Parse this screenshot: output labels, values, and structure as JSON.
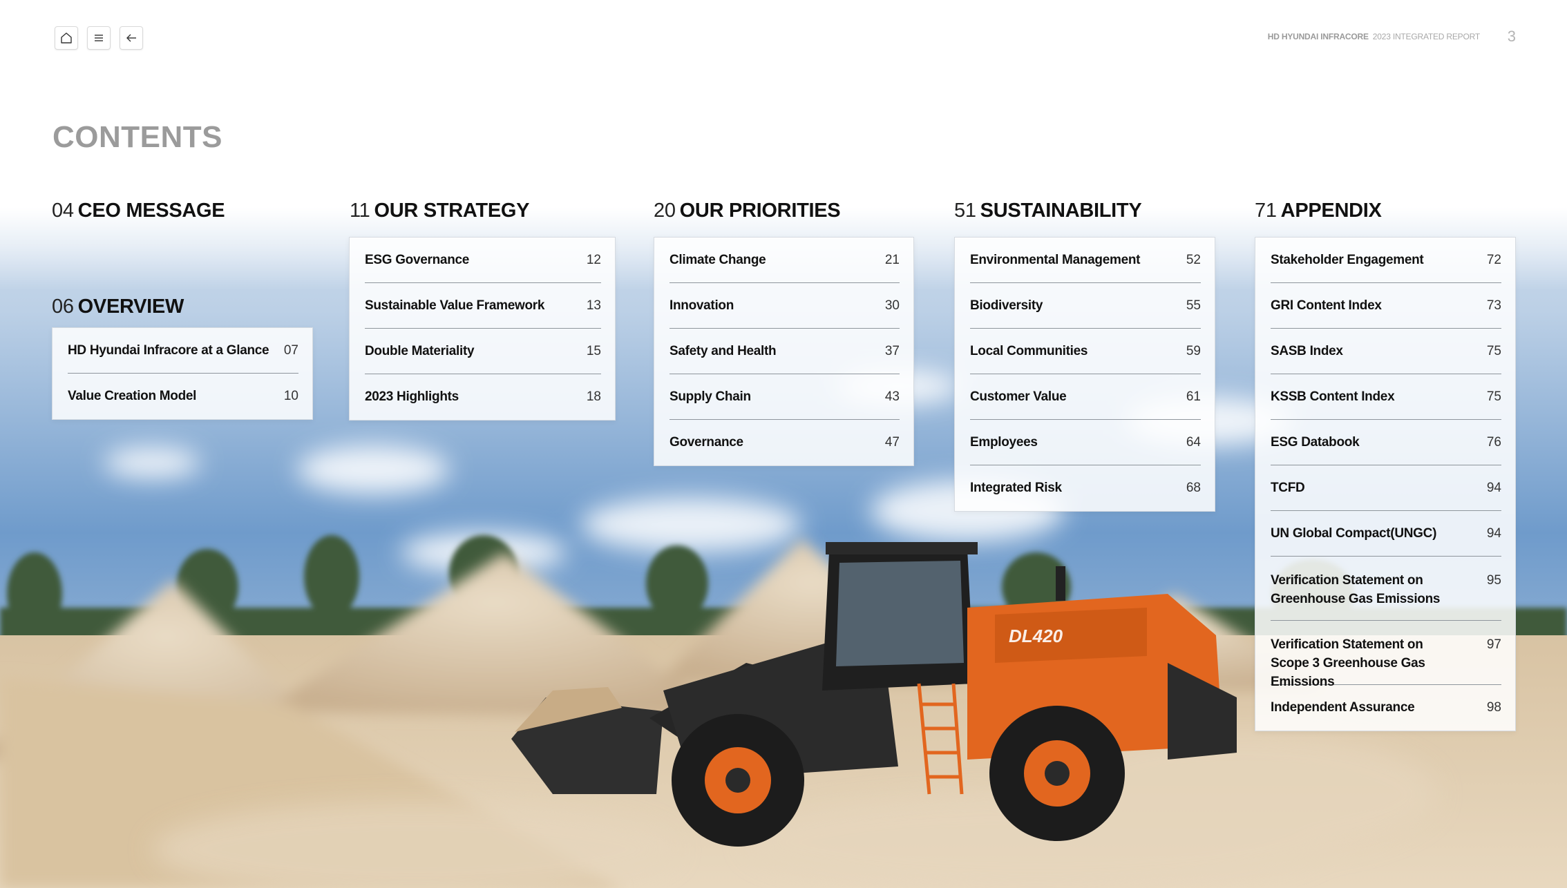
{
  "header": {
    "company": "HD HYUNDAI INFRACORE",
    "report": "2023 INTEGRATED REPORT",
    "page_number": "3"
  },
  "nav": {
    "home_icon": "home-icon",
    "menu_icon": "menu-icon",
    "back_icon": "back-arrow-icon"
  },
  "contents_title": "CONTENTS",
  "sections": [
    {
      "num": "04",
      "title": "CEO MESSAGE",
      "items": []
    },
    {
      "num": "06",
      "title": "OVERVIEW",
      "items": [
        {
          "label": "HD Hyundai Infracore at a Glance",
          "page": "07"
        },
        {
          "label": "Value Creation Model",
          "page": "10"
        }
      ]
    },
    {
      "num": "11",
      "title": "OUR STRATEGY",
      "items": [
        {
          "label": "ESG Governance",
          "page": "12"
        },
        {
          "label": "Sustainable Value Framework",
          "page": "13"
        },
        {
          "label": "Double Materiality",
          "page": "15"
        },
        {
          "label": "2023 Highlights",
          "page": "18"
        }
      ]
    },
    {
      "num": "20",
      "title": "OUR PRIORITIES",
      "items": [
        {
          "label": "Climate Change",
          "page": "21"
        },
        {
          "label": "Innovation",
          "page": "30"
        },
        {
          "label": "Safety and Health",
          "page": "37"
        },
        {
          "label": "Supply Chain",
          "page": "43"
        },
        {
          "label": "Governance",
          "page": "47"
        }
      ]
    },
    {
      "num": "51",
      "title": "SUSTAINABILITY",
      "items": [
        {
          "label": "Environmental Management",
          "page": "52"
        },
        {
          "label": "Biodiversity",
          "page": "55"
        },
        {
          "label": "Local Communities",
          "page": "59"
        },
        {
          "label": "Customer Value",
          "page": "61"
        },
        {
          "label": "Employees",
          "page": "64"
        },
        {
          "label": "Integrated Risk",
          "page": "68"
        }
      ]
    },
    {
      "num": "71",
      "title": "APPENDIX",
      "items": [
        {
          "label": "Stakeholder Engagement",
          "page": "72"
        },
        {
          "label": "GRI Content Index",
          "page": "73"
        },
        {
          "label": "SASB Index",
          "page": "75"
        },
        {
          "label": "KSSB Content Index",
          "page": "75"
        },
        {
          "label": "ESG Databook",
          "page": "76"
        },
        {
          "label": "TCFD",
          "page": "94"
        },
        {
          "label": "UN Global Compact(UNGC)",
          "page": "94"
        },
        {
          "label": "Verification Statement on\nGreenhouse Gas Emissions",
          "page": "95"
        },
        {
          "label": "Verification Statement on\nScope 3 Greenhouse Gas Emissions",
          "page": "97"
        },
        {
          "label": "Independent Assurance",
          "page": "98"
        }
      ]
    }
  ],
  "photo": {
    "machine_badge": "DL420",
    "colors": {
      "machine_orange": "#e2661f",
      "sky_blue": "#5f8fc2",
      "sand": "#dcc8a8"
    }
  }
}
